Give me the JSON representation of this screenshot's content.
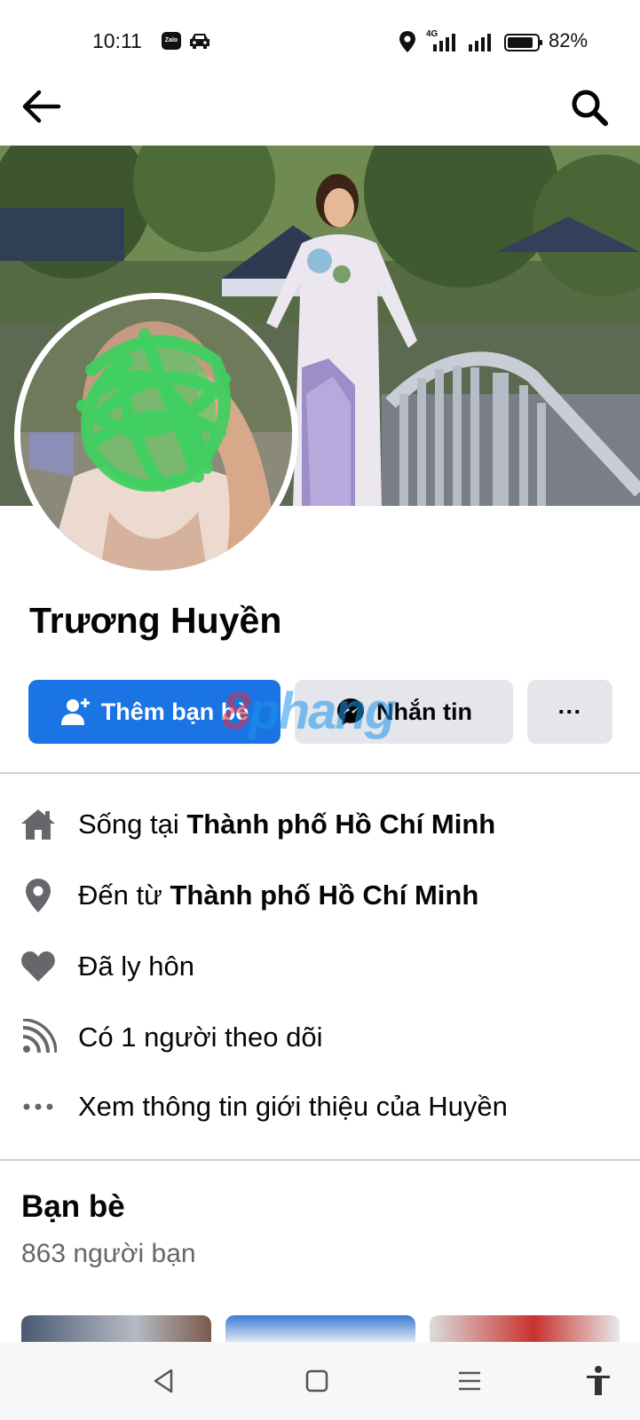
{
  "status_bar": {
    "time": "10:11",
    "network": "4G",
    "battery": "82%",
    "app_icon_label": "Zalo"
  },
  "profile": {
    "name": "Trương Huyền"
  },
  "actions": {
    "add_friend_label": "Thêm bạn bè",
    "message_label": "Nhắn tin",
    "more_label": "···",
    "watermark_text": "8phang"
  },
  "info": {
    "lives_in_prefix": "Sống tại ",
    "lives_in_city": "Thành phố Hồ Chí Minh",
    "from_prefix": "Đến từ ",
    "from_city": "Thành phố Hồ Chí Minh",
    "relationship": "Đã ly hôn",
    "followers": "Có 1 người theo dõi",
    "see_about": "Xem thông tin giới thiệu của Huyền"
  },
  "friends": {
    "title": "Bạn bè",
    "count": "863 người bạn"
  },
  "icons": {
    "back": "arrow-left-icon",
    "search": "search-icon",
    "home": "home-icon",
    "location": "location-pin-icon",
    "heart": "heart-icon",
    "feed": "rss-icon",
    "more": "ellipsis-icon"
  },
  "colors": {
    "primary": "#1b74e4",
    "secondary_button": "#e4e6eb",
    "icon_gray": "#65676b",
    "text": "#050505"
  }
}
